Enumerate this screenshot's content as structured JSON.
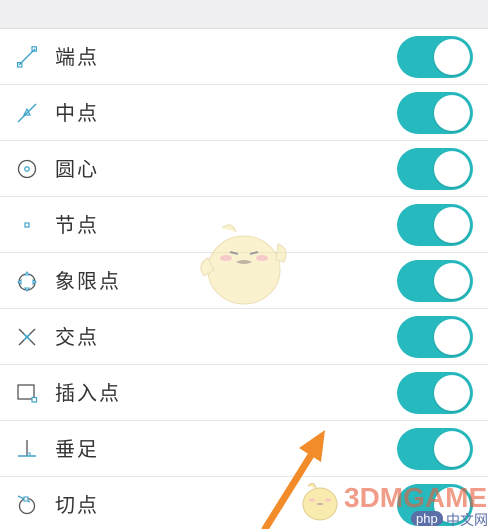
{
  "colors": {
    "toggle_on": "#26b9be",
    "icon_stroke": "#3fa3c8",
    "text": "#333333"
  },
  "settings": {
    "items": [
      {
        "label": "端点",
        "icon": "endpoint-icon",
        "enabled": true
      },
      {
        "label": "中点",
        "icon": "midpoint-icon",
        "enabled": true
      },
      {
        "label": "圆心",
        "icon": "center-icon",
        "enabled": true
      },
      {
        "label": "节点",
        "icon": "node-icon",
        "enabled": true
      },
      {
        "label": "象限点",
        "icon": "quadrant-icon",
        "enabled": true
      },
      {
        "label": "交点",
        "icon": "intersection-icon",
        "enabled": true
      },
      {
        "label": "插入点",
        "icon": "insertion-icon",
        "enabled": true
      },
      {
        "label": "垂足",
        "icon": "perpendicular-icon",
        "enabled": true
      },
      {
        "label": "切点",
        "icon": "tangent-icon",
        "enabled": true
      }
    ]
  },
  "watermark": {
    "site": "3DMGAME",
    "badge": "php",
    "badge_suffix": "中文网"
  }
}
